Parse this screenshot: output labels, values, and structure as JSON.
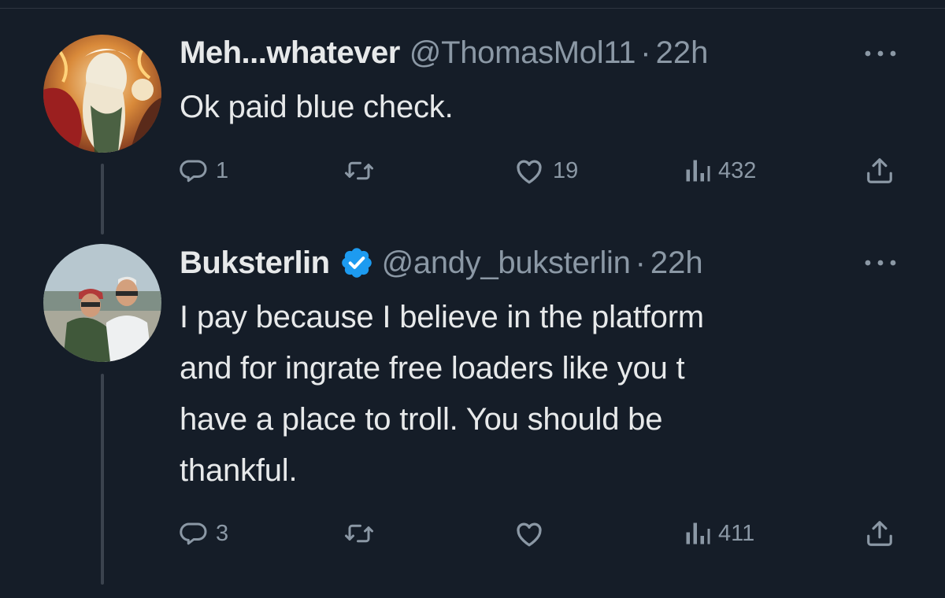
{
  "tweets": [
    {
      "display_name": "Meh...whatever",
      "verified": false,
      "handle": "@ThomasMol11",
      "separator": "·",
      "time": "22h",
      "text": "Ok paid blue check.",
      "replies": "1",
      "retweets": "",
      "likes": "19",
      "views": "432"
    },
    {
      "display_name": "Buksterlin",
      "verified": true,
      "handle": "@andy_buksterlin",
      "separator": "·",
      "time": "22h",
      "text_lines": [
        "I pay because I believe in the platform",
        "and for ingrate free loaders like you t",
        "have a place to troll. You should be",
        "thankful."
      ],
      "replies": "3",
      "retweets": "",
      "likes": "",
      "views": "411"
    }
  ],
  "colors": {
    "background": "#151d28",
    "text": "#e7e9ea",
    "secondary": "#8b98a5",
    "verified": "#1d9bf0",
    "thread_line": "#3b434e"
  },
  "icons": [
    "more-icon",
    "reply-icon",
    "retweet-icon",
    "like-icon",
    "views-icon",
    "share-icon",
    "verified-badge-icon"
  ]
}
